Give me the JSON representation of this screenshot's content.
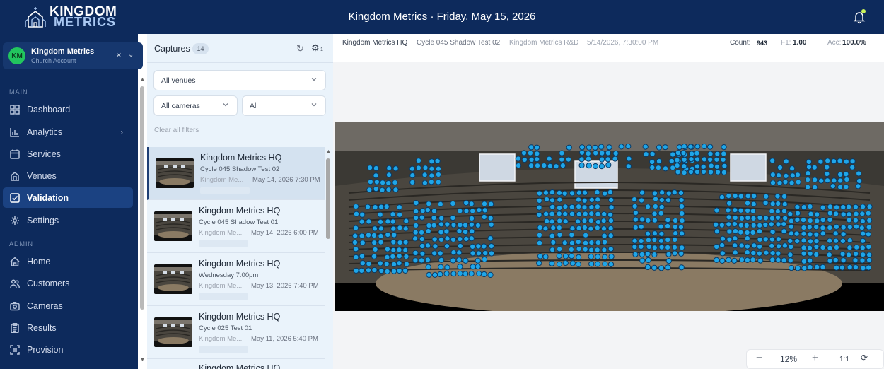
{
  "brand": {
    "line1": "KINGDOM",
    "line2": "METRICS"
  },
  "header": {
    "title": "Kingdom Metrics · Friday, May 15, 2026"
  },
  "account": {
    "initials": "KM",
    "name": "Kingdom Metrics",
    "type": "Church Account",
    "close": "×",
    "chevron": "⌄"
  },
  "sidebar": {
    "main_label": "MAIN",
    "admin_label": "ADMIN",
    "main_items": [
      {
        "label": "Dashboard",
        "icon": "dashboard-icon"
      },
      {
        "label": "Analytics",
        "icon": "analytics-icon"
      },
      {
        "label": "Services",
        "icon": "calendar-icon"
      },
      {
        "label": "Venues",
        "icon": "building-icon"
      },
      {
        "label": "Validation",
        "icon": "check-square-icon"
      },
      {
        "label": "Settings",
        "icon": "gear-icon"
      }
    ],
    "admin_items": [
      {
        "label": "Home",
        "icon": "home-icon"
      },
      {
        "label": "Customers",
        "icon": "users-icon"
      },
      {
        "label": "Cameras",
        "icon": "camera-icon"
      },
      {
        "label": "Results",
        "icon": "clipboard-icon"
      },
      {
        "label": "Provision",
        "icon": "scan-icon"
      }
    ],
    "active": "Validation"
  },
  "captures": {
    "title": "Captures",
    "count": "14",
    "gear_sub": "1",
    "filters": {
      "venue": "All venues",
      "camera": "All cameras",
      "other": "All",
      "clear": "Clear all filters"
    },
    "items": [
      {
        "title": "Kingdom Metrics HQ",
        "sub": "Cycle 045 Shadow Test 02",
        "venue": "Kingdom Me...",
        "date": "May 14, 2026 7:30 PM",
        "selected": true
      },
      {
        "title": "Kingdom Metrics HQ",
        "sub": "Cycle 045 Shadow Test 01",
        "venue": "Kingdom Me...",
        "date": "May 14, 2026 6:00 PM",
        "selected": false
      },
      {
        "title": "Kingdom Metrics HQ",
        "sub": "Wednesday 7:00pm",
        "venue": "Kingdom Me...",
        "date": "May 13, 2026 7:40 PM",
        "selected": false
      },
      {
        "title": "Kingdom Metrics HQ",
        "sub": "Cycle 025 Test 01",
        "venue": "Kingdom Me...",
        "date": "May 11, 2026 5:40 PM",
        "selected": false
      },
      {
        "title": "Kingdom Metrics HQ",
        "sub": "",
        "venue": "",
        "date": "",
        "selected": false
      }
    ]
  },
  "viewer": {
    "venue": "Kingdom Metrics HQ",
    "capture": "Cycle 045 Shadow Test 02",
    "org": "Kingdom Metrics R&D",
    "timestamp": "5/14/2026, 7:30:00 PM",
    "count_label": "Count:",
    "count_value": "943",
    "f1_label": "F1:",
    "f1_value": "1.00",
    "acc_label": "Acc:",
    "acc_value": "100.0%",
    "zoom": {
      "minus": "−",
      "level": "12%",
      "plus": "+",
      "ratio": "1:1"
    }
  },
  "colors": {
    "navy": "#0d2a5c",
    "active": "#1b4282",
    "detection": "#1fa6e8",
    "panel": "#eaf3fb"
  }
}
